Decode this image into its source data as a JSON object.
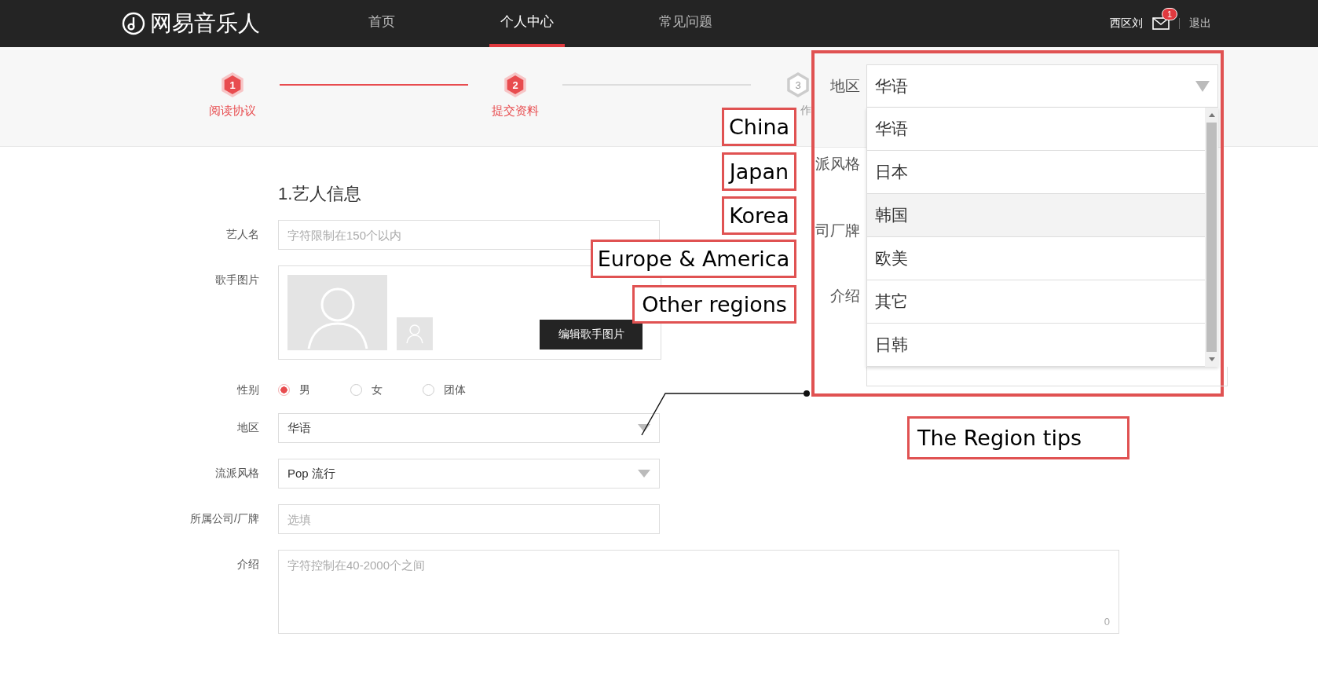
{
  "header": {
    "logo": "网易音乐人",
    "nav": [
      {
        "label": "首页",
        "selected": false
      },
      {
        "label": "个人中心",
        "selected": true
      },
      {
        "label": "常见问题",
        "selected": false
      }
    ],
    "user": "西区刘",
    "mail_badge": "1",
    "logout": "退出"
  },
  "steps": [
    {
      "number": "1",
      "label": "阅读协议",
      "active": true
    },
    {
      "number": "2",
      "label": "提交资料",
      "active": true
    },
    {
      "number": "3",
      "label": "作",
      "active": false
    }
  ],
  "form": {
    "title": "1.艺人信息",
    "fields": [
      {
        "kind": "text",
        "label": "艺人名",
        "placeholder": "字符限制在150个以内"
      },
      {
        "kind": "photo",
        "label": "歌手图片",
        "button": "编辑歌手图片"
      },
      {
        "kind": "radio",
        "label": "性别",
        "options": [
          {
            "label": "男",
            "checked": true
          },
          {
            "label": "女",
            "checked": false
          },
          {
            "label": "团体",
            "checked": false
          }
        ]
      },
      {
        "kind": "select",
        "label": "地区",
        "value": "华语"
      },
      {
        "kind": "select",
        "label": "流派风格",
        "value": "Pop 流行"
      },
      {
        "kind": "text",
        "label": "所属公司/厂牌",
        "placeholder": "选填"
      },
      {
        "kind": "textarea",
        "label": "介绍",
        "placeholder": "字符控制在40-2000个之间",
        "counter": "0"
      }
    ]
  },
  "zoom_inset": {
    "label": "地区",
    "value": "华语",
    "side_labels": [
      "派风格",
      "司厂牌",
      "介绍"
    ],
    "options": [
      {
        "label": "华语",
        "highlighted": false
      },
      {
        "label": "日本",
        "highlighted": false
      },
      {
        "label": "韩国",
        "highlighted": true
      },
      {
        "label": "欧美",
        "highlighted": false
      },
      {
        "label": "其它",
        "highlighted": false
      },
      {
        "label": "日韩",
        "highlighted": false
      }
    ]
  },
  "annotations": {
    "options": [
      "China",
      "Japan",
      "Korea",
      "Europe & America",
      "Other regions"
    ],
    "tip": "The Region tips"
  }
}
